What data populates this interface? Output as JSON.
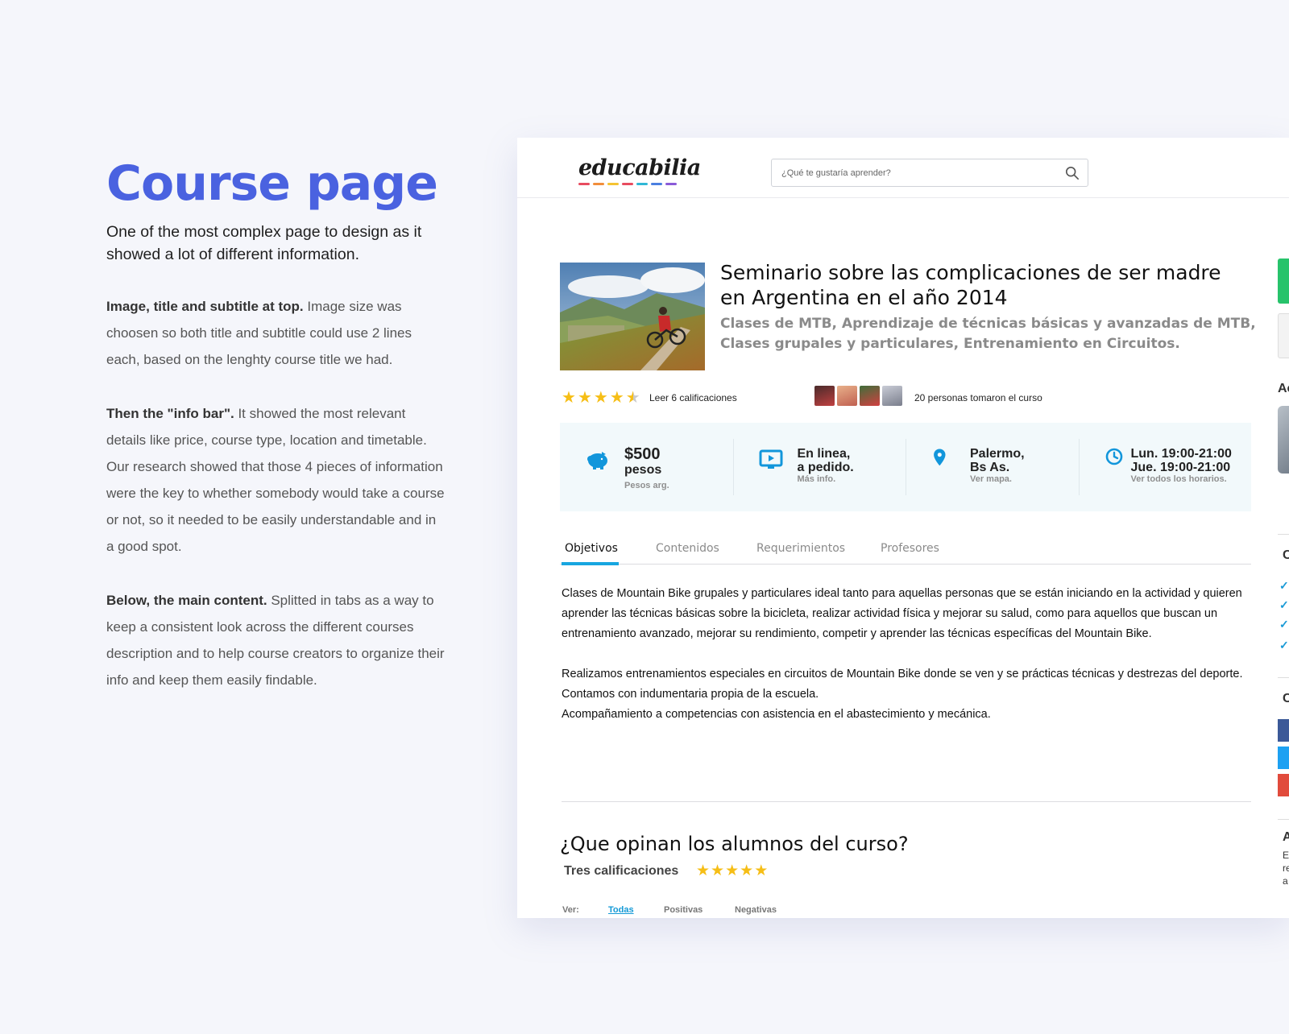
{
  "intro": {
    "heading": "Course page",
    "lead": "One of the most complex page to design as it showed a lot of different information.",
    "paragraphs": [
      {
        "bold": "Image, title and subtitle at top.",
        "text": " Image size was choosen so both title and subtitle could use 2 lines each, based on the lenghty course title we had."
      },
      {
        "bold": "Then the \"info bar\".",
        "text": " It showed the most relevant details like price, course type, location and timetable. Our research showed that those 4 pieces of information were the key to whether somebody would take a course or not, so it needed to be easily understandable and in a good spot."
      },
      {
        "bold": "Below, the main content.",
        "text": " Splitted in tabs as a way to keep a consistent look across the different courses description and to help course creators to organize their info and keep them easily findable."
      }
    ]
  },
  "app": {
    "logo": "educabilia",
    "logo_colors": [
      "#e84b5f",
      "#f18d3b",
      "#f4c332",
      "#4fc48a",
      "#2fb8d6",
      "#4a7fe0",
      "#8a5ad8"
    ],
    "search": {
      "placeholder": "¿Qué te gustaría aprender?",
      "icon": "search-icon"
    }
  },
  "course": {
    "title": "Seminario sobre las complicaciones de ser madre en Argentina en el año 2014",
    "subtitle": "Clases de MTB, Aprendizaje de técnicas básicas y avanzadas de MTB, Clases grupales y particulares, Entrenamiento en Circuitos.",
    "rating": 4.5,
    "ratings_link": "Leer 6 calificaciones",
    "takers_text": "20 personas tomaron el curso"
  },
  "info_bar": [
    {
      "icon": "piggy-bank-icon",
      "main": "$500",
      "main2": "pesos",
      "sub": "Pesos arg."
    },
    {
      "icon": "monitor-play-icon",
      "main": "En linea,",
      "main2": "a pedido.",
      "sub": "Más info."
    },
    {
      "icon": "location-pin-icon",
      "main": "Palermo,",
      "main2": "Bs As.",
      "sub": "Ver mapa."
    },
    {
      "icon": "clock-icon",
      "main": "Lun. 19:00-21:00",
      "main2": "Jue. 19:00-21:00",
      "sub": "Ver todos los horarios."
    }
  ],
  "tabs": [
    "Objetivos",
    "Contenidos",
    "Requerimientos",
    "Profesores"
  ],
  "active_tab": "Objetivos",
  "content": {
    "p1": "Clases de Mountain Bike grupales y particulares ideal tanto para aquellas personas que se están iniciando en la actividad y quieren aprender las técnicas básicas sobre la bicicleta, realizar actividad física y mejorar su salud, como para aquellos que buscan un entrenamiento avanzado, mejorar su rendimiento, competir y aprender las técnicas específicas del Mountain Bike.",
    "p2": "Realizamos entrenamientos especiales en circuitos de Mountain Bike donde se ven y se prácticas técnicas y destrezas del deporte.",
    "p3": "Contamos con indumentaria propia de la escuela.",
    "p4": "Acompañamiento a competencias con asistencia en el abastecimiento y mecánica."
  },
  "reviews": {
    "title": "¿Que opinan los alumnos del curso?",
    "count_label": "Tres calificaciones",
    "stars": 5,
    "filter_label": "Ver:",
    "filters": [
      "Todas",
      "Positivas",
      "Negativas"
    ],
    "active_filter": "Todas"
  },
  "sidebar_fragments": {
    "letter_a": "Ac",
    "letter_c1": "C",
    "letter_c2": "C",
    "letter_a2": "A",
    "frag_lines": [
      "E",
      "re",
      "a"
    ]
  },
  "colors": {
    "accent": "#4a62e0",
    "tab_active": "#17a6e0",
    "star": "#f6be16",
    "cta_green": "#27c36b",
    "info_icon": "#1296db"
  }
}
